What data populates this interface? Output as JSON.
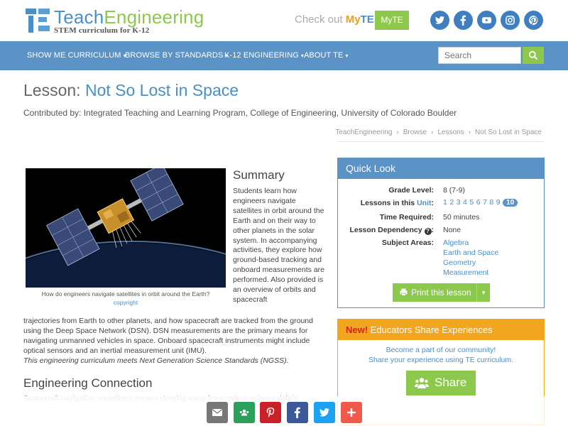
{
  "header": {
    "logo_teach": "Teach",
    "logo_engineering": "Engineering",
    "logo_sub": "STEM curriculum for K-12",
    "checkout_prefix": "Check out ",
    "checkout_my": "My",
    "checkout_te": "TE",
    "myte_button": "MyTE",
    "social_icons": [
      "twitter-icon",
      "facebook-icon",
      "youtube-icon",
      "instagram-icon",
      "pinterest-icon"
    ]
  },
  "nav": {
    "items": [
      {
        "label": "SHOW ME CURRICULUM"
      },
      {
        "label": "BROWSE BY STANDARDS"
      },
      {
        "label": "K-12 ENGINEERING"
      },
      {
        "label": "ABOUT TE"
      }
    ],
    "search_placeholder": "Search"
  },
  "lesson": {
    "prefix": "Lesson: ",
    "title": "Not So Lost in Space",
    "contributed": "Contributed by: Integrated Teaching and Learning Program, College of Engineering, University of Colorado Boulder"
  },
  "breadcrumb": [
    "TeachEngineering",
    "Browse",
    "Lessons",
    "Not So Lost in Space"
  ],
  "image": {
    "caption": "How do engineers navigate satellites in orbit around the Earth?",
    "copyright": "copyright"
  },
  "summary": {
    "heading": "Summary",
    "text_narrow": "Students learn how engineers navigate satellites in orbit around the Earth and on their way to other planets in the solar system. In accompanying activities, they explore how ground-based tracking and onboard measurements are performed. Also provided is an overview of orbits and spacecraft",
    "text_wide": "trajectories from Earth to other planets, and how spacecraft are tracked from the ground using the Deep Space Network (DSN). DSN measurements are the primary means for navigating unmanned vehicles in space. Onboard spacecraft instruments might include optical sensors and an inertial measurement unit (IMU).",
    "ngss": "This engineering curriculum meets Next Generation Science Standards (NGSS)."
  },
  "engineering": {
    "heading": "Engineering Connection",
    "text": "Spacecraft navigation sometimes means steering away from meteor science debris"
  },
  "quick_look": {
    "heading": "Quick Look",
    "grade_label": "Grade Level:",
    "grade_value": "8 (7-9)",
    "lessons_label_prefix": "Lessons in this ",
    "lessons_label_unit": "Unit",
    "lessons_label_suffix": ":",
    "lesson_numbers": [
      "1",
      "2",
      "3",
      "4",
      "5",
      "6",
      "7",
      "8",
      "9"
    ],
    "lesson_current": "10",
    "time_label": "Time Required:",
    "time_value": "50 minutes",
    "dependency_label": "Lesson Dependency",
    "dependency_value": "None",
    "subject_label": "Subject Areas:",
    "subjects": [
      "Algebra",
      "Earth and Space",
      "Geometry",
      "Measurement"
    ],
    "print_button": "Print this lesson"
  },
  "share_box": {
    "new": "New!",
    "heading": " Educators Share Experiences",
    "line1": "Become a part of our community!",
    "line2": "Share your experience using TE curriculum.",
    "button": "Share"
  },
  "bottom_bar": {
    "buttons": [
      {
        "icon": "email-icon",
        "color": "#777777"
      },
      {
        "icon": "google-classroom-icon",
        "color": "#2aa05a"
      },
      {
        "icon": "pinterest-icon",
        "color": "#cb2027"
      },
      {
        "icon": "facebook-icon",
        "color": "#3b5998"
      },
      {
        "icon": "twitter-icon",
        "color": "#1da1f2"
      },
      {
        "icon": "plus-icon",
        "color": "#f15a4a"
      }
    ]
  },
  "colors": {
    "brand_blue": "#4a90c8",
    "nav_blue": "#5b93c7",
    "brand_green": "#8cc84b",
    "share_orange": "#f2a620"
  }
}
